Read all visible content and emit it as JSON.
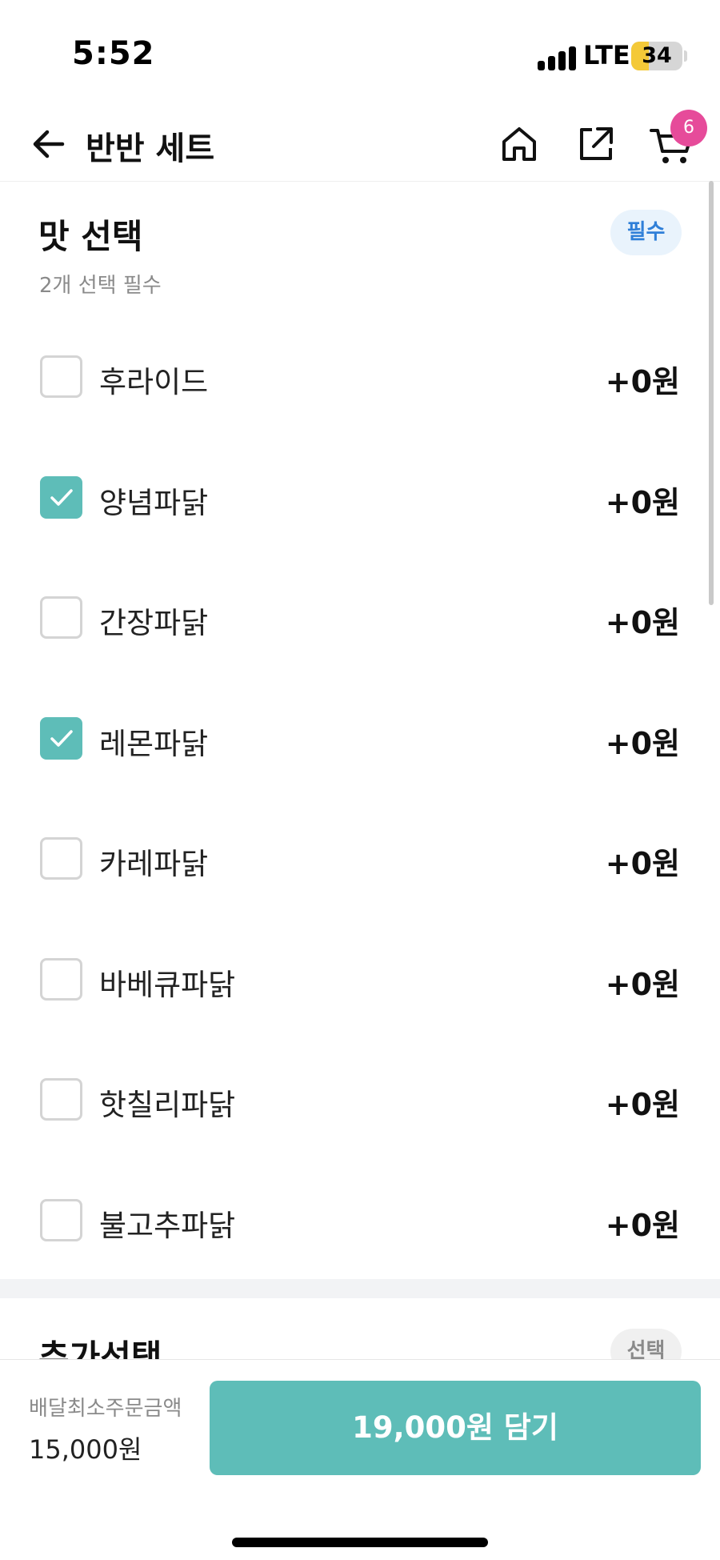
{
  "status_bar": {
    "time": "5:52",
    "network": "LTE",
    "battery": "34"
  },
  "nav": {
    "title": "반반 세트",
    "cart_count": "6"
  },
  "section": {
    "title": "맛 선택",
    "subtitle": "2개 선택 필수",
    "badge": "필수",
    "options": [
      {
        "label": "후라이드",
        "price": "+0원",
        "checked": false
      },
      {
        "label": "양념파닭",
        "price": "+0원",
        "checked": true
      },
      {
        "label": "간장파닭",
        "price": "+0원",
        "checked": false
      },
      {
        "label": "레몬파닭",
        "price": "+0원",
        "checked": true
      },
      {
        "label": "카레파닭",
        "price": "+0원",
        "checked": false
      },
      {
        "label": "바베큐파닭",
        "price": "+0원",
        "checked": false
      },
      {
        "label": "핫칠리파닭",
        "price": "+0원",
        "checked": false
      },
      {
        "label": "불고추파닭",
        "price": "+0원",
        "checked": false
      }
    ]
  },
  "section2": {
    "title": "추가선택",
    "badge": "선택"
  },
  "bottom": {
    "min_order_label": "배달최소주문금액",
    "min_order_value": "15,000원",
    "add_button": "19,000원 담기"
  },
  "colors": {
    "accent": "#5ebdb8",
    "badge_pink": "#e64b9a",
    "required_blue": "#2f7fd8"
  },
  "icons": {
    "back": "arrow-left-icon",
    "home": "home-icon",
    "share": "share-icon",
    "cart": "cart-icon",
    "check": "checkmark-icon"
  }
}
